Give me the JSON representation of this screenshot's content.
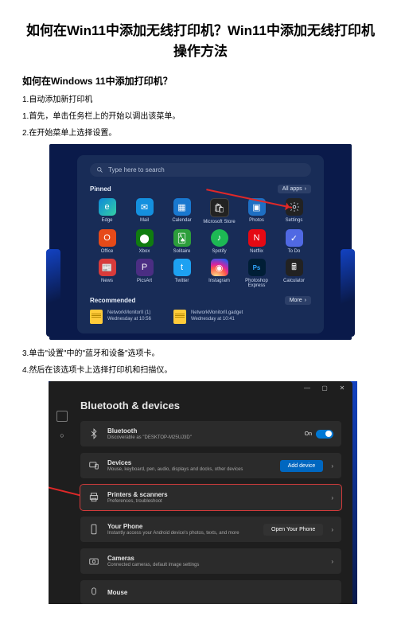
{
  "title": "如何在Win11中添加无线打印机？Win11中添加无线打印机操作方法",
  "heading2": "如何在Windows 11中添加打印机？",
  "steps": {
    "s1": "1.自动添加新打印机",
    "s2": "1.首先，单击任务栏上的开始以调出该菜单。",
    "s3": "2.在开始菜单上选择设置。",
    "s4": "3.单击\"设置\"中的\"蓝牙和设备\"选项卡。",
    "s5": "4.然后在该选项卡上选择打印机和扫描仪。"
  },
  "startMenu": {
    "searchPlaceholder": "Type here to search",
    "pinnedLabel": "Pinned",
    "allApps": "All apps",
    "recommendedLabel": "Recommended",
    "moreLabel": "More",
    "tiles": [
      {
        "name": "Edge"
      },
      {
        "name": "Mail"
      },
      {
        "name": "Calendar"
      },
      {
        "name": "Microsoft Store"
      },
      {
        "name": "Photos"
      },
      {
        "name": "Settings"
      },
      {
        "name": "Office"
      },
      {
        "name": "Xbox"
      },
      {
        "name": "Solitaire"
      },
      {
        "name": "Spotify"
      },
      {
        "name": "Netflix"
      },
      {
        "name": "To Do"
      },
      {
        "name": "News"
      },
      {
        "name": "PicsArt"
      },
      {
        "name": "Twitter"
      },
      {
        "name": "Instagram"
      },
      {
        "name": "Photoshop Express"
      },
      {
        "name": "Calculator"
      }
    ],
    "rec1": {
      "title": "NetworkMonitorII (1)",
      "sub": "Wednesday at 10:56"
    },
    "rec2": {
      "title": "NetworkMonitorII.gadget",
      "sub": "Wednesday at 10:41"
    }
  },
  "settingsWin": {
    "pageTitle": "Bluetooth & devices",
    "bluetooth": {
      "h": "Bluetooth",
      "s": "Discoverable as \"DESKTOP-M25UJ3D\"",
      "toggle": "On"
    },
    "devices": {
      "h": "Devices",
      "s": "Mouse, keyboard, pen, audio, displays and docks, other devices",
      "btn": "Add device"
    },
    "printers": {
      "h": "Printers & scanners",
      "s": "Preferences, troubleshoot"
    },
    "phone": {
      "h": "Your Phone",
      "s": "Instantly access your Android device's photos, texts, and more",
      "btn": "Open Your Phone"
    },
    "cameras": {
      "h": "Cameras",
      "s": "Connected cameras, default image settings"
    },
    "mouse": {
      "h": "Mouse"
    }
  }
}
